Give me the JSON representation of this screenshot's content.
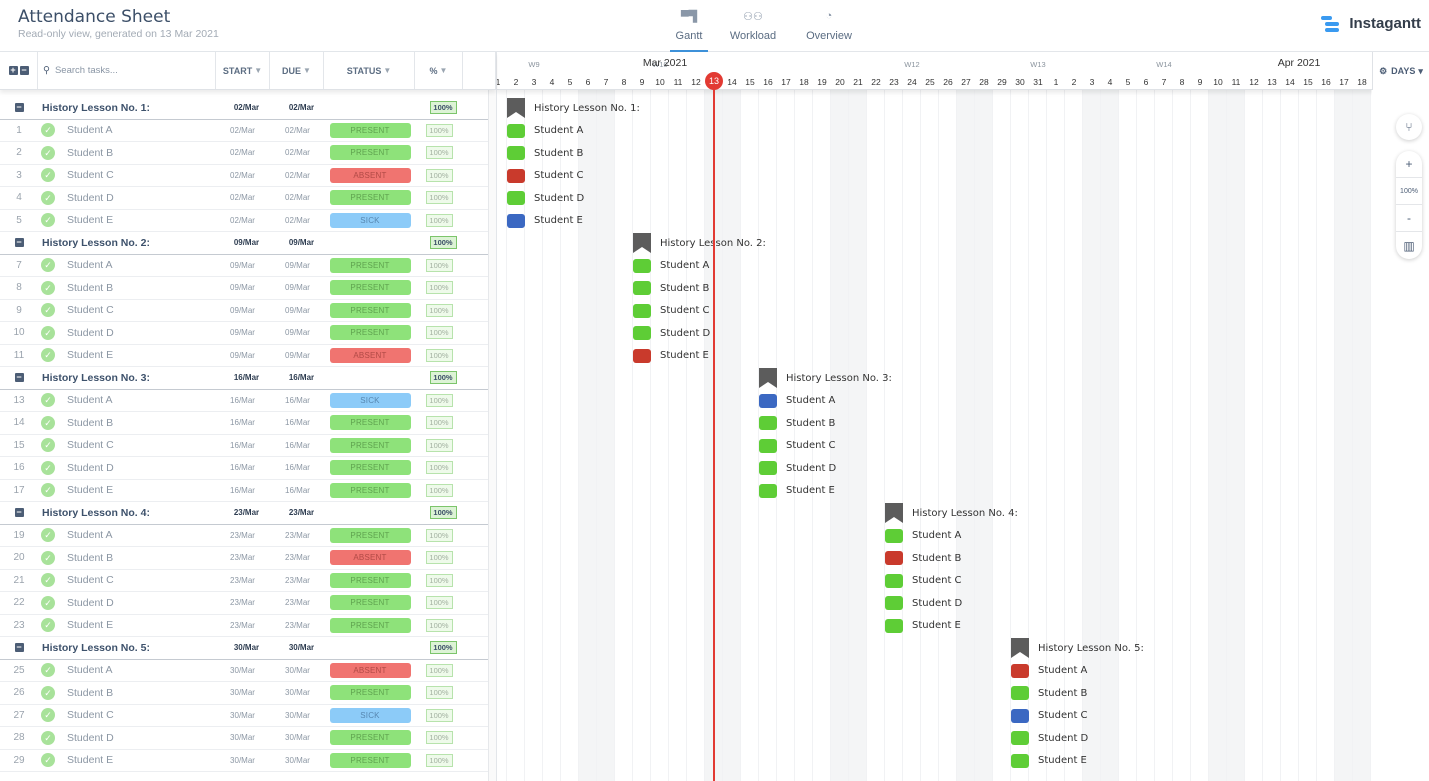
{
  "header": {
    "title": "Attendance Sheet",
    "subtitle": "Read-only view, generated on 13 Mar 2021",
    "tabs": [
      {
        "label": "Gantt",
        "icon": "gantt-icon",
        "active": true
      },
      {
        "label": "Workload",
        "icon": "users-icon"
      },
      {
        "label": "Overview",
        "icon": "gauge-icon"
      }
    ],
    "brand": "Instagantt"
  },
  "grid": {
    "search_placeholder": "Search tasks...",
    "columns": {
      "start": "START",
      "due": "DUE",
      "status": "STATUS",
      "pct": "%"
    }
  },
  "colors": {
    "present": "#8ee27a",
    "absent": "#f07470",
    "sick": "#8ccbf8",
    "gantt_present": "#5ecd36",
    "gantt_absent": "#c93a2c",
    "gantt_sick": "#3b68c2",
    "today": "#e23a33"
  },
  "groups": [
    {
      "name": "History Lesson No. 1:",
      "start": "02/Mar",
      "due": "02/Mar",
      "pct": "100%",
      "day": 2,
      "students": [
        {
          "n": "1",
          "name": "Student A",
          "s": "PRESENT"
        },
        {
          "n": "2",
          "name": "Student B",
          "s": "PRESENT"
        },
        {
          "n": "3",
          "name": "Student C",
          "s": "ABSENT"
        },
        {
          "n": "4",
          "name": "Student D",
          "s": "PRESENT"
        },
        {
          "n": "5",
          "name": "Student E",
          "s": "SICK"
        }
      ]
    },
    {
      "name": "History Lesson No. 2:",
      "start": "09/Mar",
      "due": "09/Mar",
      "pct": "100%",
      "day": 9,
      "students": [
        {
          "n": "7",
          "name": "Student A",
          "s": "PRESENT"
        },
        {
          "n": "8",
          "name": "Student B",
          "s": "PRESENT"
        },
        {
          "n": "9",
          "name": "Student C",
          "s": "PRESENT"
        },
        {
          "n": "10",
          "name": "Student D",
          "s": "PRESENT"
        },
        {
          "n": "11",
          "name": "Student E",
          "s": "ABSENT"
        }
      ]
    },
    {
      "name": "History Lesson No. 3:",
      "start": "16/Mar",
      "due": "16/Mar",
      "pct": "100%",
      "day": 16,
      "students": [
        {
          "n": "13",
          "name": "Student A",
          "s": "SICK"
        },
        {
          "n": "14",
          "name": "Student B",
          "s": "PRESENT"
        },
        {
          "n": "15",
          "name": "Student C",
          "s": "PRESENT"
        },
        {
          "n": "16",
          "name": "Student D",
          "s": "PRESENT"
        },
        {
          "n": "17",
          "name": "Student E",
          "s": "PRESENT"
        }
      ]
    },
    {
      "name": "History Lesson No. 4:",
      "start": "23/Mar",
      "due": "23/Mar",
      "pct": "100%",
      "day": 23,
      "students": [
        {
          "n": "19",
          "name": "Student A",
          "s": "PRESENT"
        },
        {
          "n": "20",
          "name": "Student B",
          "s": "ABSENT"
        },
        {
          "n": "21",
          "name": "Student C",
          "s": "PRESENT"
        },
        {
          "n": "22",
          "name": "Student D",
          "s": "PRESENT"
        },
        {
          "n": "23",
          "name": "Student E",
          "s": "PRESENT"
        }
      ]
    },
    {
      "name": "History Lesson No. 5:",
      "start": "30/Mar",
      "due": "30/Mar",
      "pct": "100%",
      "day": 30,
      "students": [
        {
          "n": "25",
          "name": "Student A",
          "s": "ABSENT"
        },
        {
          "n": "26",
          "name": "Student B",
          "s": "PRESENT"
        },
        {
          "n": "27",
          "name": "Student C",
          "s": "SICK"
        },
        {
          "n": "28",
          "name": "Student D",
          "s": "PRESENT"
        },
        {
          "n": "29",
          "name": "Student E",
          "s": "PRESENT"
        }
      ]
    }
  ],
  "timeline": {
    "months": [
      {
        "label": "Mar 2021",
        "day": 11
      },
      {
        "label": "Apr 2021",
        "day": 16,
        "month": "Apr"
      }
    ],
    "weeks": [
      {
        "label": "W9",
        "day": 3
      },
      {
        "label": "W10",
        "day": 10
      },
      {
        "label": "W12",
        "day": 24
      },
      {
        "label": "W13",
        "day": 31
      },
      {
        "label": "W14",
        "day": 38
      }
    ],
    "days": [
      "1",
      "2",
      "3",
      "4",
      "5",
      "6",
      "7",
      "8",
      "9",
      "10",
      "11",
      "12",
      "13",
      "14",
      "15",
      "16",
      "17",
      "18",
      "19",
      "20",
      "21",
      "22",
      "23",
      "24",
      "25",
      "26",
      "27",
      "28",
      "29",
      "30",
      "31",
      "1",
      "2",
      "3",
      "4",
      "5",
      "6",
      "7",
      "8",
      "9",
      "10",
      "11",
      "12",
      "13",
      "14",
      "15",
      "16",
      "17",
      "18"
    ],
    "weekend_days": [
      6,
      7,
      13,
      14,
      20,
      21,
      27,
      28,
      34,
      35,
      41,
      42,
      48,
      49
    ],
    "today": "13",
    "scale": "DAYS"
  },
  "zoom": {
    "plus": "+",
    "level": "100%",
    "minus": "-"
  }
}
